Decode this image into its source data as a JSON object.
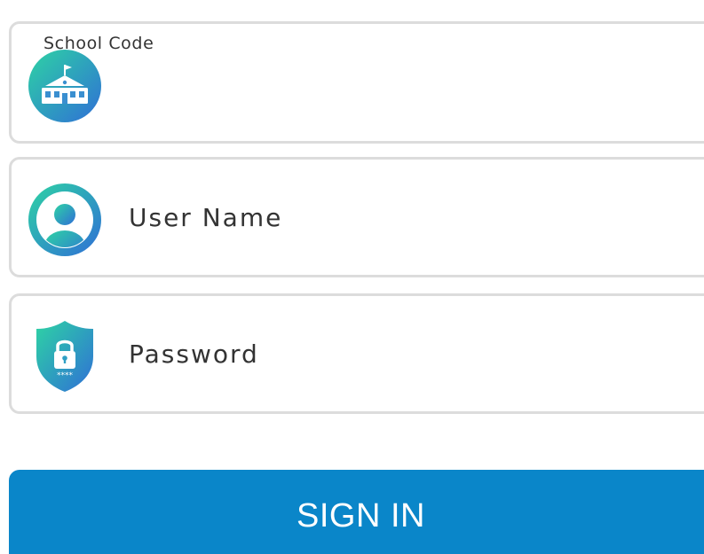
{
  "form": {
    "school_code": {
      "legend": "School Code",
      "value": "",
      "icon": "school-building-icon"
    },
    "user_name": {
      "placeholder": "User Name",
      "value": "",
      "icon": "user-avatar-icon"
    },
    "password": {
      "placeholder": "Password",
      "value": "",
      "icon": "lock-shield-icon"
    }
  },
  "sign_in": {
    "label": "SIGN IN"
  },
  "colors": {
    "primary": "#0a86c9",
    "icon_gradient_start": "#2ed3a4",
    "icon_gradient_end": "#2f6fd6",
    "field_border": "#dcdcdc",
    "text": "#333333"
  }
}
